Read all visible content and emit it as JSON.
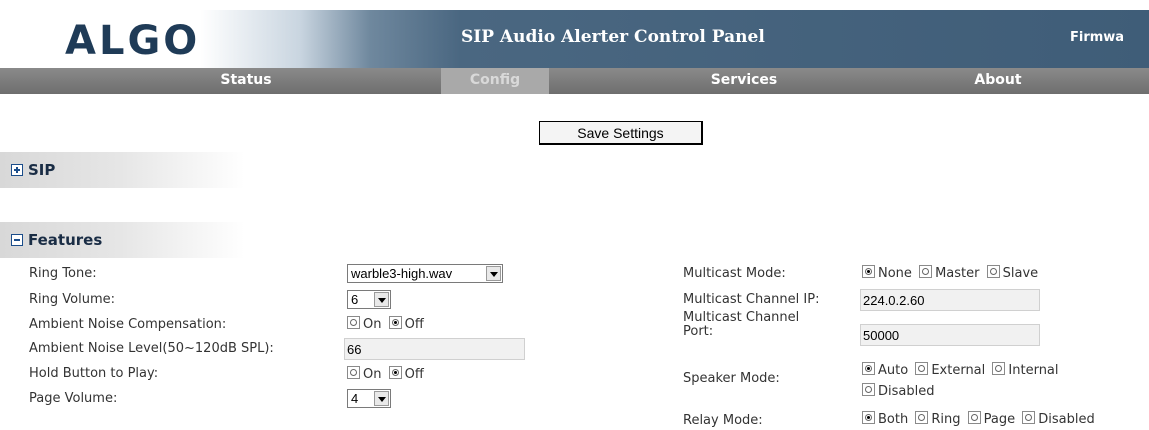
{
  "header": {
    "logo": "ALGO",
    "title": "SIP Audio Alerter Control Panel",
    "firmware": "Firmwa"
  },
  "nav": [
    "Status",
    "Config",
    "Services",
    "About"
  ],
  "save_label": "Save Settings",
  "sections": {
    "sip": "SIP",
    "features": "Features"
  },
  "left": {
    "ring_tone_label": "Ring Tone:",
    "ring_tone_value": "warble3-high.wav",
    "ring_volume_label": "Ring Volume:",
    "ring_volume_value": "6",
    "anc_label": "Ambient Noise Compensation:",
    "anc_on": "On",
    "anc_off": "Off",
    "anl_label": "Ambient Noise Level(50~120dB SPL):",
    "anl_value": "66",
    "hold_label": "Hold Button to Play:",
    "hold_on": "On",
    "hold_off": "Off",
    "page_volume_label": "Page Volume:",
    "page_volume_value": "4"
  },
  "right": {
    "multicast_mode_label": "Multicast Mode:",
    "mm_none": "None",
    "mm_master": "Master",
    "mm_slave": "Slave",
    "mc_ip_label": "Multicast Channel IP:",
    "mc_ip_value": "224.0.2.60",
    "mc_port_label_1": "Multicast Channel",
    "mc_port_label_2": "Port:",
    "mc_port_value": "50000",
    "speaker_mode_label": "Speaker Mode:",
    "sp_auto": "Auto",
    "sp_external": "External",
    "sp_internal": "Internal",
    "sp_disabled": "Disabled",
    "relay_mode_label": "Relay Mode:",
    "rl_both": "Both",
    "rl_ring": "Ring",
    "rl_page": "Page",
    "rl_disabled": "Disabled"
  },
  "colors": {
    "brand": "#1f3b57",
    "header_dark": "#3f5d78",
    "nav_bg": "#7a7a7a",
    "nav_active": "#a9a9a9"
  }
}
